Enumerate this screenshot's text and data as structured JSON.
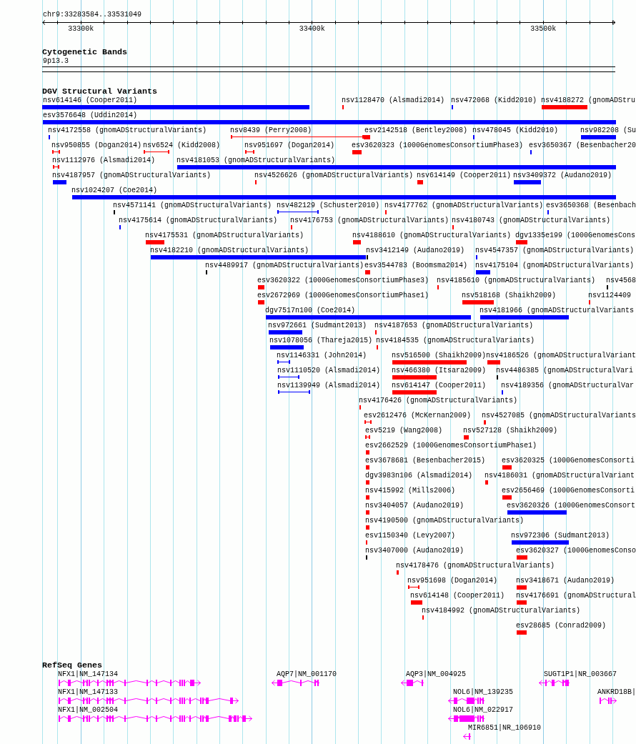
{
  "view": {
    "location": "chr9:33283584..33531049",
    "ticks": [
      "33300k",
      "33400k",
      "33500k"
    ]
  },
  "tracks": [
    {
      "kind": "cytoband",
      "title": "Cytogenetic Bands",
      "band": "9p13.3"
    },
    {
      "kind": "variants",
      "title": "DGV Structural Variants",
      "features": [
        {
          "label": "nsv614146 (Cooper2011)",
          "color": "#0000ff",
          "kind": "bar"
        },
        {
          "label": "nsv1128470 (Alsmadi2014)",
          "color": "#ff0000",
          "kind": "bar"
        },
        {
          "label": "nsv472068 (Kidd2010)",
          "color": "#0000ff",
          "kind": "bar"
        },
        {
          "label": "nsv4188272 (gnomADStru",
          "color": "#ff0000",
          "kind": "bar"
        },
        {
          "label": "esv3576648 (Uddin2014)",
          "color": "#0000ff",
          "kind": "bar"
        },
        {
          "label": "nsv4172558 (gnomADStructuralVariants)",
          "color": "#0000ff",
          "kind": "bar"
        },
        {
          "label": "nsv8439 (Perry2008)",
          "color": "#ff0000",
          "kind": "span"
        },
        {
          "label": "esv2142518 (Bentley2008)",
          "color": "#ff0000",
          "kind": "bar"
        },
        {
          "label": "nsv478045 (Kidd2010)",
          "color": "#0000ff",
          "kind": "bar"
        },
        {
          "label": "nsv982208 (Su",
          "color": "#0000ff",
          "kind": "bar"
        },
        {
          "label": "nsv950855 (Dogan2014)",
          "color": "#ff0000",
          "kind": "span"
        },
        {
          "label": "nsv6524 (Kidd2008)",
          "color": "#ff0000",
          "kind": "span"
        },
        {
          "label": "nsv951697 (Dogan2014)",
          "color": "#ff0000",
          "kind": "span"
        },
        {
          "label": "esv3620323 (1000GenomesConsortiumPhase3)",
          "color": "#ff0000",
          "kind": "bar"
        },
        {
          "label": "esv3650367 (Besenbacher20",
          "color": "#0000ff",
          "kind": "bar"
        },
        {
          "label": "nsv1112976 (Alsmadi2014)",
          "color": "#ff0000",
          "kind": "span"
        },
        {
          "label": "nsv4181053 (gnomADStructuralVariants)",
          "color": "#0000ff",
          "kind": "bar"
        },
        {
          "label": "nsv4187957 (gnomADStructuralVariants)",
          "color": "#0000ff",
          "kind": "bar"
        },
        {
          "label": "nsv4526626 (gnomADStructuralVariants)",
          "color": "#ff0000",
          "kind": "bar"
        },
        {
          "label": "nsv614149 (Cooper2011)",
          "color": "#ff0000",
          "kind": "bar"
        },
        {
          "label": "nsv3409372 (Audano2019)",
          "color": "#0000ff",
          "kind": "bar"
        },
        {
          "label": "nsv1024207 (Coe2014)",
          "color": "#0000ff",
          "kind": "bar"
        },
        {
          "label": "nsv4571141 (gnomADStructuralVariants)",
          "color": "#000000",
          "kind": "bar"
        },
        {
          "label": "nsv482129 (Schuster2010)",
          "color": "#0000ff",
          "kind": "span"
        },
        {
          "label": "nsv4177762 (gnomADStructuralVariants)",
          "color": "#ff0000",
          "kind": "bar"
        },
        {
          "label": "esv3650368 (Besenbach",
          "color": "#0000ff",
          "kind": "bar"
        },
        {
          "label": "nsv4175614 (gnomADStructuralVariants)",
          "color": "#0000ff",
          "kind": "bar"
        },
        {
          "label": "nsv4176753 (gnomADStructuralVariants)",
          "color": "#ff0000",
          "kind": "bar"
        },
        {
          "label": "nsv4180743 (gnomADStructuralVariants)",
          "color": "#ff0000",
          "kind": "bar"
        },
        {
          "label": "nsv4175531 (gnomADStructuralVariants)",
          "color": "#ff0000",
          "kind": "bar"
        },
        {
          "label": "nsv4188610 (gnomADStructuralVariants)",
          "color": "#ff0000",
          "kind": "bar"
        },
        {
          "label": "dgv1335e199 (1000GenomesCons",
          "color": "#ff0000",
          "kind": "bar"
        },
        {
          "label": "nsv4182210 (gnomADStructuralVariants)",
          "color": "#0000ff",
          "kind": "bar"
        },
        {
          "label": "nsv3412149 (Audano2019)",
          "color": "#000000",
          "kind": "bar"
        },
        {
          "label": "nsv4547357 (gnomADStructuralVariants)",
          "color": "#0000ff",
          "kind": "bar"
        },
        {
          "label": "nsv4489917 (gnomADStructuralVariants)",
          "color": "#000000",
          "kind": "bar"
        },
        {
          "label": "esv3544783 (Boomsma2014)",
          "color": "#ff0000",
          "kind": "bar"
        },
        {
          "label": "nsv4175104 (gnomADStructuralVariants)",
          "color": "#0000ff",
          "kind": "bar"
        },
        {
          "label": "esv3620322 (1000GenomesConsortiumPhase3)",
          "color": "#ff0000",
          "kind": "bar"
        },
        {
          "label": "nsv4185610 (gnomADStructuralVariants)",
          "color": "#ff0000",
          "kind": "bar"
        },
        {
          "label": "nsv4568",
          "color": "#000000",
          "kind": "bar"
        },
        {
          "label": "esv2672969 (1000GenomesConsortiumPhase1)",
          "color": "#ff0000",
          "kind": "bar"
        },
        {
          "label": "nsv518168 (Shaikh2009)",
          "color": "#ff0000",
          "kind": "bar"
        },
        {
          "label": "nsv1124409",
          "color": "#ff0000",
          "kind": "bar"
        },
        {
          "label": "dgv7517n100 (Coe2014)",
          "color": "#0000ff",
          "kind": "bar"
        },
        {
          "label": "nsv4181966 (gnomADStructuralVariants",
          "color": "#0000ff",
          "kind": "bar"
        },
        {
          "label": "nsv972661 (Sudmant2013)",
          "color": "#0000ff",
          "kind": "bar"
        },
        {
          "label": "nsv4187653 (gnomADStructuralVariants)",
          "color": "#ff0000",
          "kind": "bar"
        },
        {
          "label": "nsv1078056 (Thareja2015)",
          "color": "#0000ff",
          "kind": "bar"
        },
        {
          "label": "nsv4184535 (gnomADStructuralVariants)",
          "color": "#ff0000",
          "kind": "bar"
        },
        {
          "label": "nsv1146331 (John2014)",
          "color": "#0000ff",
          "kind": "span"
        },
        {
          "label": "nsv516500 (Shaikh2009)",
          "color": "#ff0000",
          "kind": "bar"
        },
        {
          "label": "nsv4186526 (gnomADStructuralVariant",
          "color": "#ff0000",
          "kind": "bar"
        },
        {
          "label": "nsv1110520 (Alsmadi2014)",
          "color": "#0000ff",
          "kind": "span"
        },
        {
          "label": "nsv466380 (Itsara2009)",
          "color": "#ff0000",
          "kind": "bar"
        },
        {
          "label": "nsv4486385 (gnomADStructuralVari",
          "color": "#000000",
          "kind": "bar"
        },
        {
          "label": "nsv1139949 (Alsmadi2014)",
          "color": "#0000ff",
          "kind": "span"
        },
        {
          "label": "nsv614147 (Cooper2011)",
          "color": "#ff0000",
          "kind": "bar"
        },
        {
          "label": "nsv4189356 (gnomADStructuralVar",
          "color": "#0000ff",
          "kind": "bar"
        },
        {
          "label": "nsv4176426 (gnomADStructuralVariants)",
          "color": "#ff0000",
          "kind": "bar"
        },
        {
          "label": "esv2612476 (McKernan2009)",
          "color": "#ff0000",
          "kind": "span"
        },
        {
          "label": "nsv4527085 (gnomADStructuralVariants",
          "color": "#ff0000",
          "kind": "bar"
        },
        {
          "label": "esv5219 (Wang2008)",
          "color": "#ff0000",
          "kind": "span"
        },
        {
          "label": "nsv527128 (Shaikh2009)",
          "color": "#ff0000",
          "kind": "bar"
        },
        {
          "label": "esv2662529 (1000GenomesConsortiumPhase1)",
          "color": "#ff0000",
          "kind": "bar"
        },
        {
          "label": "esv3678681 (Besenbacher2015)",
          "color": "#ff0000",
          "kind": "bar"
        },
        {
          "label": "esv3620325 (1000GenomesConsorti",
          "color": "#ff0000",
          "kind": "bar"
        },
        {
          "label": "dgv3983n106 (Alsmadi2014)",
          "color": "#ff0000",
          "kind": "bar"
        },
        {
          "label": "nsv4186031 (gnomADStructuralVariant",
          "color": "#ff0000",
          "kind": "bar"
        },
        {
          "label": "nsv415992 (Mills2006)",
          "color": "#ff0000",
          "kind": "bar"
        },
        {
          "label": "esv2656469 (1000GenomesConsorti",
          "color": "#ff0000",
          "kind": "bar"
        },
        {
          "label": "nsv3404057 (Audano2019)",
          "color": "#ff0000",
          "kind": "bar"
        },
        {
          "label": "esv3620326 (1000GenomesConsort",
          "color": "#0000ff",
          "kind": "bar"
        },
        {
          "label": "nsv4190500 (gnomADStructuralVariants)",
          "color": "#ff0000",
          "kind": "bar"
        },
        {
          "label": "esv1150340 (Levy2007)",
          "color": "#ff0000",
          "kind": "bar"
        },
        {
          "label": "nsv972306 (Sudmant2013)",
          "color": "#0000ff",
          "kind": "bar"
        },
        {
          "label": "nsv3407000 (Audano2019)",
          "color": "#000000",
          "kind": "bar"
        },
        {
          "label": "esv3620327 (1000GenomesConso",
          "color": "#ff0000",
          "kind": "bar"
        },
        {
          "label": "nsv4178476 (gnomADStructuralVariants)",
          "color": "#ff0000",
          "kind": "bar"
        },
        {
          "label": "nsv951698 (Dogan2014)",
          "color": "#ff0000",
          "kind": "span"
        },
        {
          "label": "nsv3418671 (Audano2019)",
          "color": "#ff0000",
          "kind": "bar"
        },
        {
          "label": "nsv614148 (Cooper2011)",
          "color": "#ff0000",
          "kind": "bar"
        },
        {
          "label": "nsv4176691 (gnomADStructural",
          "color": "#ff0000",
          "kind": "bar"
        },
        {
          "label": "nsv4184992 (gnomADStructuralVariants)",
          "color": "#ff0000",
          "kind": "bar"
        },
        {
          "label": "esv28685 (Conrad2009)",
          "color": "#ff0000",
          "kind": "bar"
        }
      ]
    },
    {
      "kind": "genes",
      "title": "RefSeq Genes",
      "features": [
        {
          "label": "NFX1|NM_147134",
          "reverse_strand": false
        },
        {
          "label": "AQP7|NM_001170",
          "reverse_strand": true
        },
        {
          "label": "AQP3|NM_004925",
          "reverse_strand": true
        },
        {
          "label": "SUGT1P1|NR_003667",
          "reverse_strand": true
        },
        {
          "label": "NFX1|NM_147133",
          "reverse_strand": false
        },
        {
          "label": "NOL6|NM_139235",
          "reverse_strand": true
        },
        {
          "label": "ANKRD18B|",
          "reverse_strand": false
        },
        {
          "label": "NFX1|NM_002504",
          "reverse_strand": false
        },
        {
          "label": "NOL6|NM_022917",
          "reverse_strand": true
        },
        {
          "label": "MIR6851|NR_106910",
          "reverse_strand": true
        }
      ]
    }
  ]
}
